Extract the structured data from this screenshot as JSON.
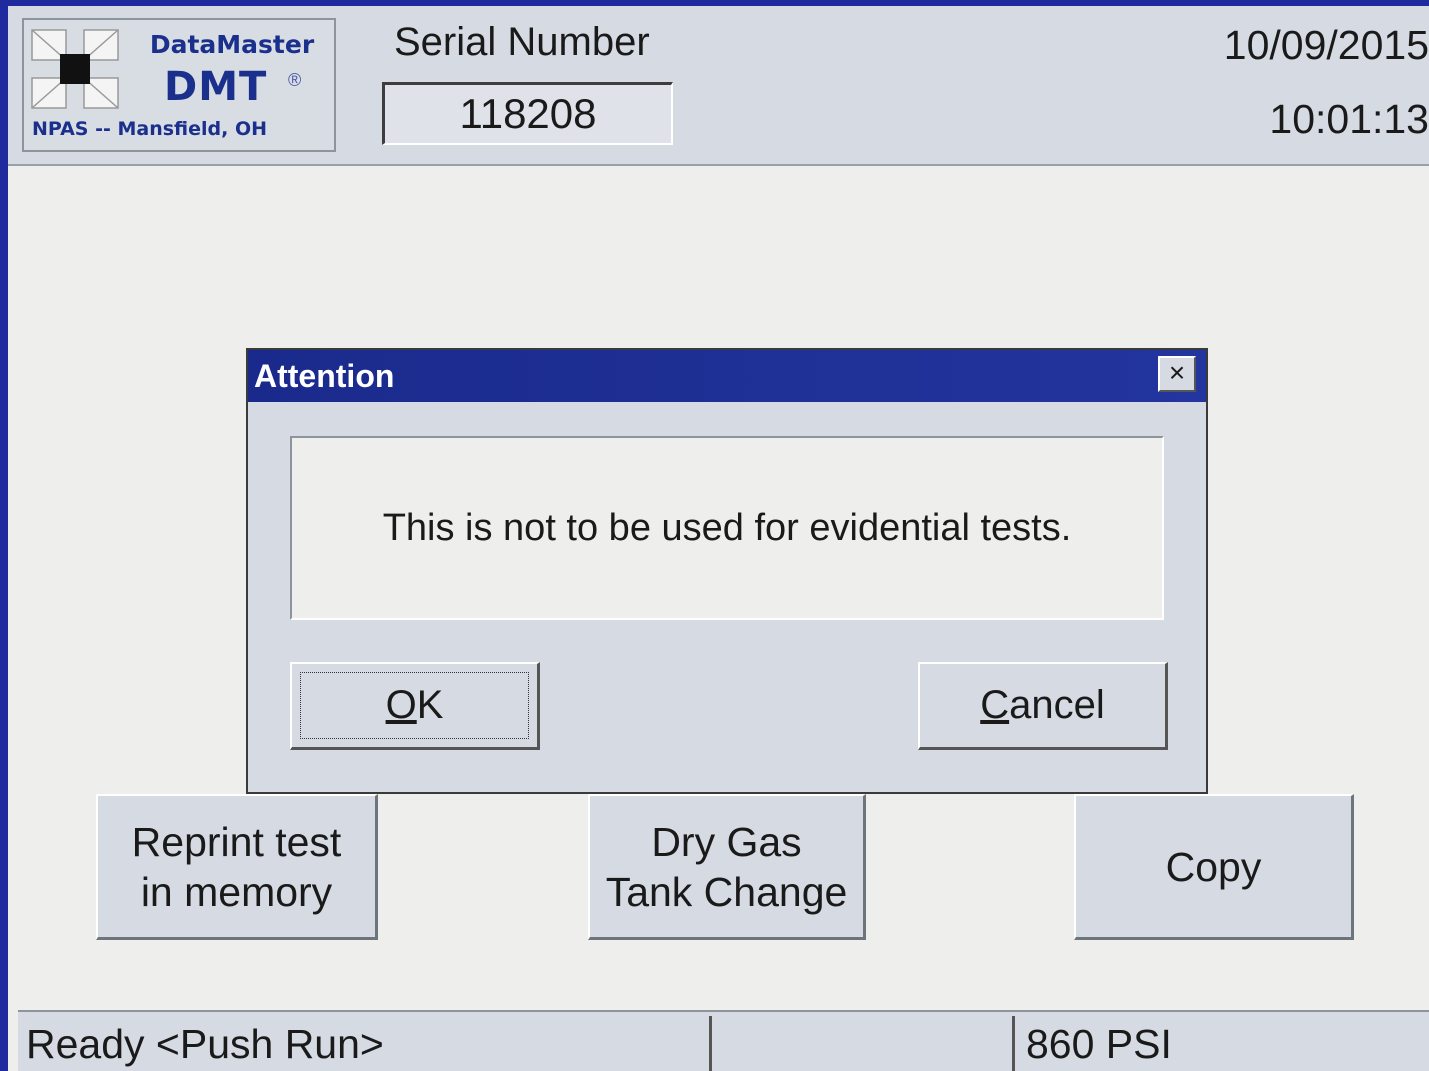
{
  "header": {
    "logo": {
      "brand": "DataMaster",
      "model": "DMT",
      "registered_mark": "®",
      "location": "NPAS -- Mansfield, OH"
    },
    "serial_label": "Serial Number",
    "serial_value": "118208",
    "date": "10/09/2015",
    "time": "10:01:13"
  },
  "menu_buttons": {
    "reprint": "Reprint test\nin memory",
    "drygas": "Dry Gas\nTank Change",
    "copy": "Copy"
  },
  "dialog": {
    "title": "Attention",
    "close_glyph": "×",
    "message": "This is not to be used for evidential tests.",
    "ok_label": "OK",
    "cancel_label": "Cancel"
  },
  "statusbar": {
    "left": "Ready <Push Run>",
    "middle": "",
    "right": "860 PSI"
  },
  "colors": {
    "frame": "#1e2a9e",
    "titlebar": "#1a2a8c",
    "panel": "#d6dbe3",
    "background": "#eeeeec",
    "logo_text": "#1b2f8c"
  }
}
